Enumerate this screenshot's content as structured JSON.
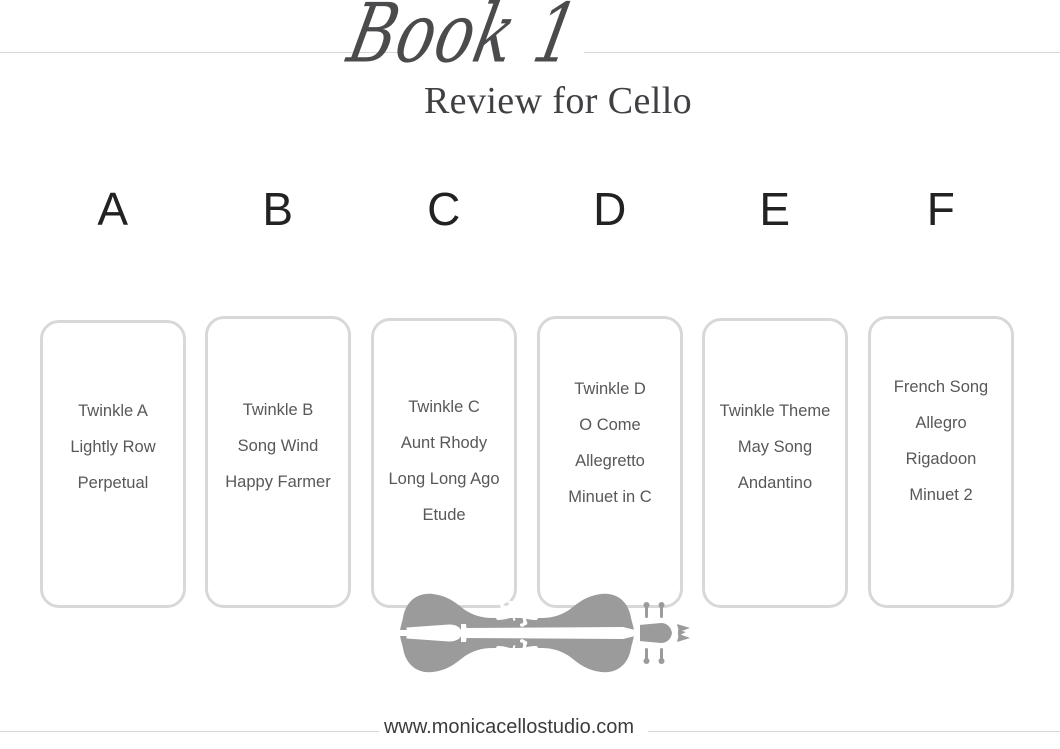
{
  "page": {
    "background_color": "#ffffff",
    "rule_color": "#d7d7d9",
    "card_border_color": "#d8d8d9",
    "cello_color": "#9b9b9b",
    "text_color": "#58585b",
    "heading_color": "#222224"
  },
  "header": {
    "book_title": "Book 1",
    "subtitle": "Review for Cello"
  },
  "columns": [
    {
      "letter": "A",
      "items": [
        "Twinkle A",
        "Lightly Row",
        "Perpetual"
      ]
    },
    {
      "letter": "B",
      "items": [
        "Twinkle B",
        "Song Wind",
        "Happy Farmer"
      ]
    },
    {
      "letter": "C",
      "items": [
        "Twinkle C",
        "Aunt Rhody",
        "Long Long Ago",
        "Etude"
      ]
    },
    {
      "letter": "D",
      "items": [
        "Twinkle D",
        "O Come",
        "Allegretto",
        "Minuet in C"
      ]
    },
    {
      "letter": "E",
      "items": [
        "Twinkle Theme",
        "May Song",
        "Andantino"
      ]
    },
    {
      "letter": "F",
      "items": [
        "French Song",
        "Allegro",
        "Rigadoon",
        "Minuet 2"
      ]
    }
  ],
  "illustration": {
    "name": "cello-icon"
  },
  "footer": {
    "site_url": "www.monicacellostudio.com"
  }
}
